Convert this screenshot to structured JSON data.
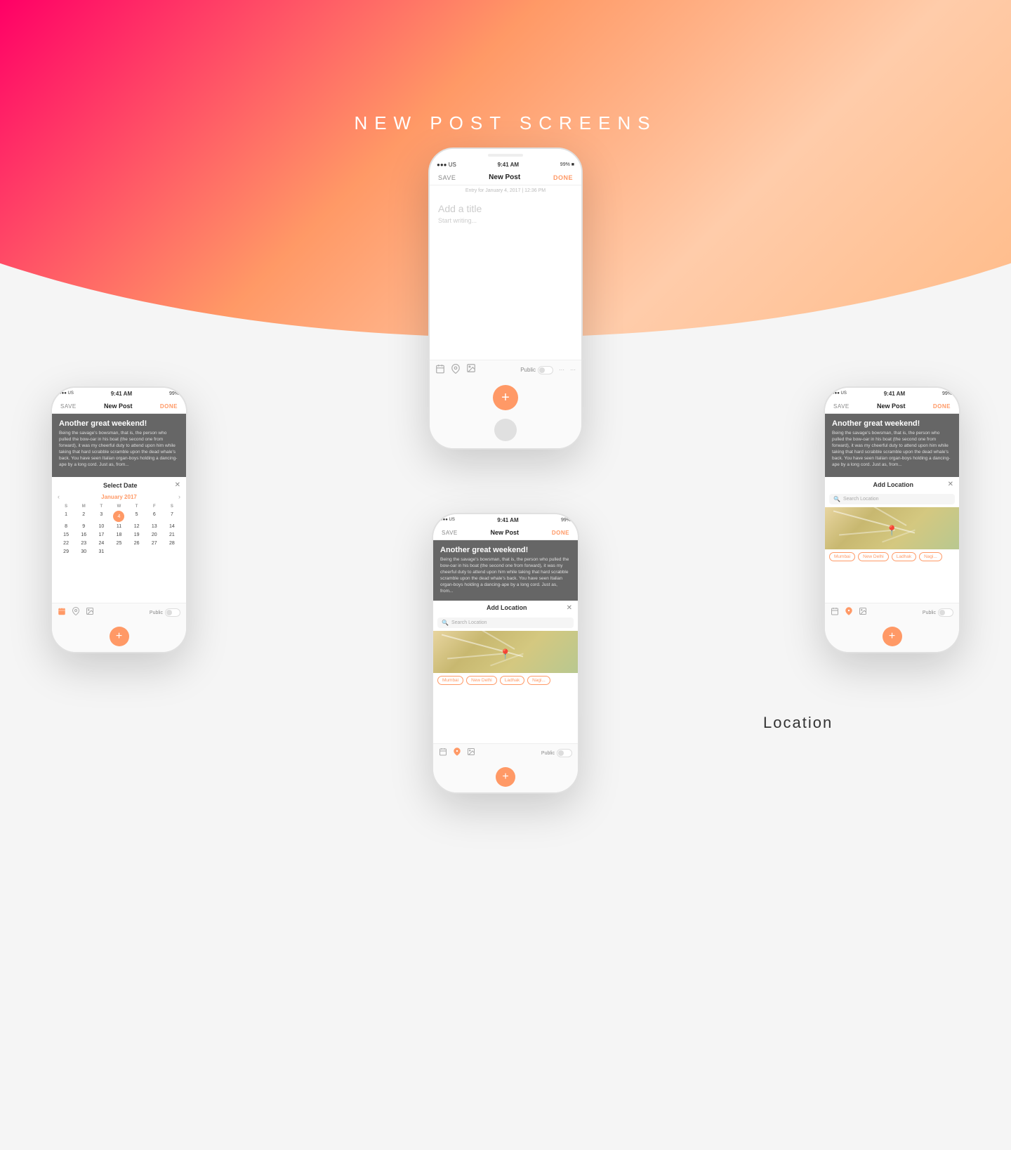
{
  "page": {
    "title": "NEW POST SCREENS",
    "background_gradient_start": "#ff0066",
    "background_gradient_end": "#ffbb88"
  },
  "center_phone": {
    "status": {
      "carrier": "●●● US",
      "wifi": "▼",
      "time": "9:41 AM",
      "battery": "99% ■"
    },
    "nav": {
      "save": "SAVE",
      "title": "New Post",
      "done": "DONE"
    },
    "entry_date": "Entry for January 4, 2017 | 12:36 PM",
    "title_placeholder": "Add a title",
    "body_placeholder": "Start writing...",
    "toolbar": {
      "icons": [
        "calendar",
        "location",
        "image",
        "public"
      ],
      "public_label": "Public"
    }
  },
  "left_phone": {
    "status": {
      "carrier": "●●● US",
      "time": "9:41 AM",
      "battery": "99%"
    },
    "nav": {
      "save": "SAVE",
      "title": "New Post",
      "done": "DONE"
    },
    "post": {
      "title": "Another great weekend!",
      "body": "Being the savage's bowsman, that is, the person who pulled the bow-oar in his boat (the second one from forward), it was my cheerful duty to attend upon him while taking that hard scrabble scramble upon the dead whale's back. You have seen Italian organ-boys holding a dancing-ape by a long cord. Just as, from..."
    },
    "calendar": {
      "title": "Select Date",
      "month": "January 2017",
      "day_headers": [
        "S",
        "M",
        "T",
        "W",
        "T",
        "F",
        "S"
      ],
      "days": [
        "",
        "",
        "",
        "",
        "",
        "",
        "1",
        "2",
        "3",
        "4",
        "5",
        "6",
        "7",
        "8",
        "9",
        "10",
        "11",
        "12",
        "13",
        "14",
        "15",
        "16",
        "17",
        "18",
        "19",
        "20",
        "21",
        "22",
        "23",
        "24",
        "25",
        "26",
        "27",
        "28",
        "29",
        "30",
        "31"
      ],
      "today": "4"
    },
    "toolbar": {
      "public_label": "Public"
    }
  },
  "center_bottom_phone": {
    "status": {
      "carrier": "●●● US",
      "time": "9:41 AM",
      "battery": "99%"
    },
    "nav": {
      "save": "SAVE",
      "title": "New Post",
      "done": "DONE"
    },
    "post": {
      "title": "Another great weekend!",
      "body": "Being the savage's bowsman, that is, the person who pulled the bow-oar in his boat (the second one from forward), it was my cheerful duty to attend upon him while taking that hard scrabble scramble upon the dead whale's back. You have seen Italian organ-boys holding a dancing-ape by a long cord. Just as, from..."
    },
    "location_panel": {
      "title": "Add Location",
      "search_placeholder": "Search Location",
      "chips": [
        "Mumbai",
        "New Delhi",
        "Ladhak",
        "Nagi..."
      ]
    },
    "toolbar": {
      "public_label": "Public"
    }
  },
  "right_phone": {
    "status": {
      "carrier": "●●● US",
      "time": "9:41 AM",
      "battery": "99%"
    },
    "nav": {
      "save": "SAVE",
      "title": "New Post",
      "done": "DONE"
    },
    "post": {
      "title": "Another great weekend!",
      "body": "Being the savage's bowsman, that is, the person who pulled the bow-oar in his boat (the second one from forward), it was my cheerful duty to attend upon him while taking that hard scrabble scramble upon the dead whale's back. You have seen Italian organ-boys holding a dancing-ape by a long cord. Just as, from..."
    },
    "location_panel": {
      "title": "Add Location",
      "search_placeholder": "Search Location",
      "chips": [
        "Mumbai",
        "New Delhi",
        "Ladhak",
        "Nagi..."
      ]
    },
    "toolbar": {
      "public_label": "Public"
    }
  },
  "icons": {
    "calendar": "📅",
    "location": "📍",
    "image": "🖼",
    "close": "✕",
    "search": "🔍",
    "chevron_left": "‹",
    "chevron_right": "›",
    "plus": "+"
  }
}
